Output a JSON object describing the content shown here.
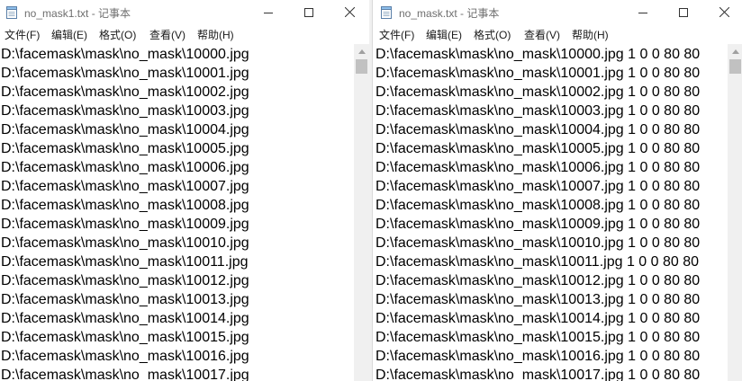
{
  "left": {
    "title": "no_mask1.txt - 记事本",
    "menu": [
      "文件(F)",
      "编辑(E)",
      "格式(O)",
      "查看(V)",
      "帮助(H)"
    ],
    "lines": [
      "D:\\facemask\\mask\\no_mask\\10000.jpg",
      "D:\\facemask\\mask\\no_mask\\10001.jpg",
      "D:\\facemask\\mask\\no_mask\\10002.jpg",
      "D:\\facemask\\mask\\no_mask\\10003.jpg",
      "D:\\facemask\\mask\\no_mask\\10004.jpg",
      "D:\\facemask\\mask\\no_mask\\10005.jpg",
      "D:\\facemask\\mask\\no_mask\\10006.jpg",
      "D:\\facemask\\mask\\no_mask\\10007.jpg",
      "D:\\facemask\\mask\\no_mask\\10008.jpg",
      "D:\\facemask\\mask\\no_mask\\10009.jpg",
      "D:\\facemask\\mask\\no_mask\\10010.jpg",
      "D:\\facemask\\mask\\no_mask\\10011.jpg",
      "D:\\facemask\\mask\\no_mask\\10012.jpg",
      "D:\\facemask\\mask\\no_mask\\10013.jpg",
      "D:\\facemask\\mask\\no_mask\\10014.jpg",
      "D:\\facemask\\mask\\no_mask\\10015.jpg",
      "D:\\facemask\\mask\\no_mask\\10016.jpg",
      "D:\\facemask\\mask\\no_mask\\10017.jpg"
    ]
  },
  "right": {
    "title": "no_mask.txt - 记事本",
    "menu": [
      "文件(F)",
      "编辑(E)",
      "格式(O)",
      "查看(V)",
      "帮助(H)"
    ],
    "lines": [
      "D:\\facemask\\mask\\no_mask\\10000.jpg 1 0 0 80 80",
      "D:\\facemask\\mask\\no_mask\\10001.jpg 1 0 0 80 80",
      "D:\\facemask\\mask\\no_mask\\10002.jpg 1 0 0 80 80",
      "D:\\facemask\\mask\\no_mask\\10003.jpg 1 0 0 80 80",
      "D:\\facemask\\mask\\no_mask\\10004.jpg 1 0 0 80 80",
      "D:\\facemask\\mask\\no_mask\\10005.jpg 1 0 0 80 80",
      "D:\\facemask\\mask\\no_mask\\10006.jpg 1 0 0 80 80",
      "D:\\facemask\\mask\\no_mask\\10007.jpg 1 0 0 80 80",
      "D:\\facemask\\mask\\no_mask\\10008.jpg 1 0 0 80 80",
      "D:\\facemask\\mask\\no_mask\\10009.jpg 1 0 0 80 80",
      "D:\\facemask\\mask\\no_mask\\10010.jpg 1 0 0 80 80",
      "D:\\facemask\\mask\\no_mask\\10011.jpg 1 0 0 80 80",
      "D:\\facemask\\mask\\no_mask\\10012.jpg 1 0 0 80 80",
      "D:\\facemask\\mask\\no_mask\\10013.jpg 1 0 0 80 80",
      "D:\\facemask\\mask\\no_mask\\10014.jpg 1 0 0 80 80",
      "D:\\facemask\\mask\\no_mask\\10015.jpg 1 0 0 80 80",
      "D:\\facemask\\mask\\no_mask\\10016.jpg 1 0 0 80 80",
      "D:\\facemask\\mask\\no_mask\\10017.jpg 1 0 0 80 80"
    ]
  },
  "icons": {
    "app": "notepad-icon",
    "minimize": "minimize-icon",
    "maximize": "maximize-icon",
    "close": "close-icon",
    "scroll_up": "scroll-up-arrow-icon"
  },
  "colors": {
    "title_text": "#6e6e6e",
    "scrollbar_track": "#f0f0f0",
    "scrollbar_thumb": "#c1c1c1"
  }
}
